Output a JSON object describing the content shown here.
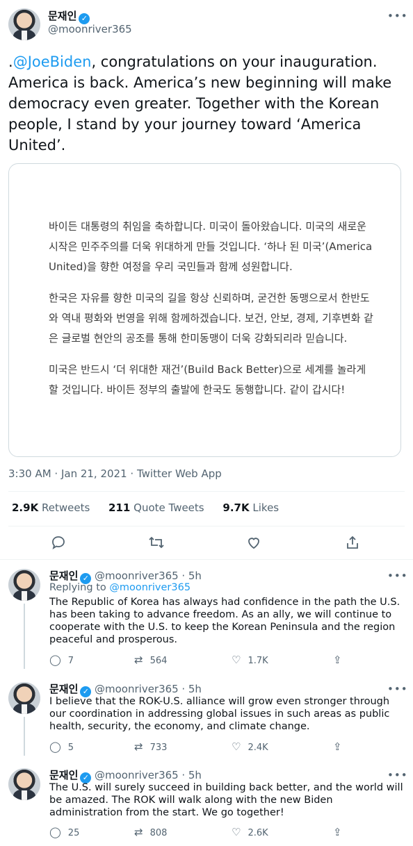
{
  "main_tweet": {
    "author_name": "문재인",
    "author_handle": "@moonriver365",
    "text_prefix": ".",
    "mention": "@JoeBiden",
    "text_rest": ", congratulations on your inauguration. America is back. America’s new beginning will make democracy even greater. Together with the Korean people, I stand by your journey toward ‘America United’.",
    "image_paragraphs": [
      "바이든 대통령의 취임을 축하합니다. 미국이 돌아왔습니다. 미국의 새로운 시작은 민주주의를 더욱 위대하게 만들 것입니다. ‘하나 된 미국’(America United)을 향한 여정을 우리 국민들과 함께 성원합니다.",
      "한국은 자유를 향한 미국의 길을 항상 신뢰하며, 굳건한 동맹으로서 한반도와 역내 평화와 번영을 위해 함께하겠습니다. 보건, 안보, 경제, 기후변화 같은 글로벌 현안의 공조를 통해 한미동맹이 더욱 강화되리라 믿습니다.",
      "미국은 반드시 ‘더 위대한 재건’(Build Back Better)으로 세계를 놀라게 할 것입니다. 바이든 정부의 출발에 한국도 동행합니다. 같이 갑시다!"
    ],
    "timestamp": "3:30 AM · Jan 21, 2021 · Twitter Web App",
    "stats": {
      "retweets_count": "2.9K",
      "retweets_label": "Retweets",
      "quotes_count": "211",
      "quotes_label": "Quote Tweets",
      "likes_count": "9.7K",
      "likes_label": "Likes"
    }
  },
  "replies": [
    {
      "name": "문재인",
      "handle": "@moonriver365",
      "time": "· 5h",
      "replying_to_label": "Replying to",
      "replying_to": "@moonriver365",
      "text": "The Republic of Korea has always had confidence in the path the U.S. has been taking to advance freedom. As an ally, we will continue to cooperate with the U.S. to keep the Korean Peninsula and the region peaceful and prosperous.",
      "replies": "7",
      "retweets": "564",
      "likes": "1.7K"
    },
    {
      "name": "문재인",
      "handle": "@moonriver365",
      "time": "· 5h",
      "text": "I believe that the ROK-U.S. alliance will grow even stronger through our coordination in addressing global issues in such areas as public health, security, the economy, and climate change.",
      "replies": "5",
      "retweets": "733",
      "likes": "2.4K"
    },
    {
      "name": "문재인",
      "handle": "@moonriver365",
      "time": "· 5h",
      "text": "The U.S. will surely succeed in building back better, and the world will be amazed. The ROK will walk along with the new Biden administration from the start. We go together!",
      "replies": "25",
      "retweets": "808",
      "likes": "2.6K"
    }
  ],
  "icons": {
    "more": "more-icon",
    "verified": "verified-badge-icon",
    "reply": "reply-icon",
    "retweet": "retweet-icon",
    "like": "heart-icon",
    "share": "share-icon"
  },
  "colors": {
    "accent": "#1d9bf0",
    "text": "#0f1419",
    "muted": "#536471",
    "border": "#cfd9de"
  }
}
